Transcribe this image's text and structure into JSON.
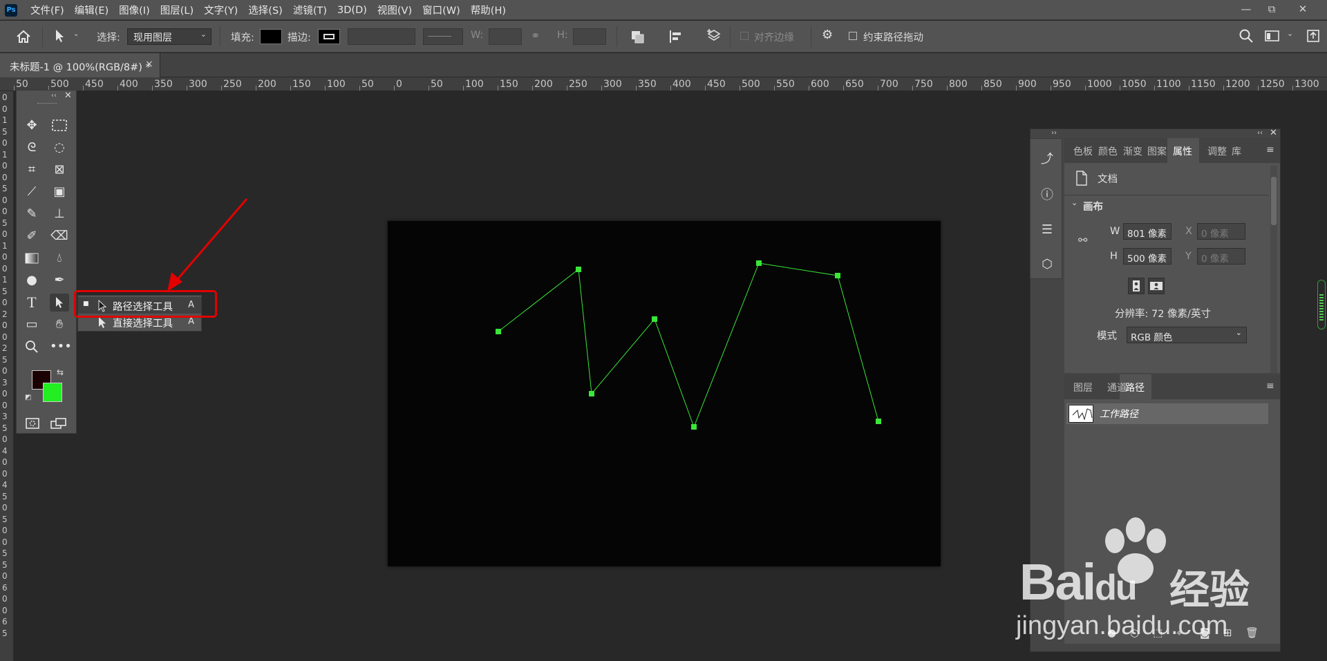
{
  "app": {
    "logo": "Ps"
  },
  "menu": [
    "文件(F)",
    "编辑(E)",
    "图像(I)",
    "图层(L)",
    "文字(Y)",
    "选择(S)",
    "滤镜(T)",
    "3D(D)",
    "视图(V)",
    "窗口(W)",
    "帮助(H)"
  ],
  "window_controls": {
    "minimize": "—",
    "restore": "⧉",
    "close": "✕"
  },
  "options": {
    "select_label": "选择:",
    "select_value": "现用图层",
    "fill_label": "填充:",
    "stroke_label": "描边:",
    "w_label": "W:",
    "h_label": "H:",
    "align_edges": "对齐边缘",
    "constrain_path": "约束路径拖动"
  },
  "document": {
    "tab_title": "未标题-1 @ 100%(RGB/8#) *",
    "close": "×"
  },
  "ruler_top": [
    "50",
    "500",
    "450",
    "400",
    "350",
    "300",
    "250",
    "200",
    "150",
    "100",
    "50",
    "0",
    "50",
    "100",
    "150",
    "200",
    "250",
    "300",
    "350",
    "400",
    "450",
    "500",
    "550",
    "600",
    "650",
    "700",
    "750",
    "800",
    "850",
    "900",
    "950",
    "1000",
    "1050",
    "1100",
    "1150",
    "1200",
    "1250",
    "1300"
  ],
  "ruler_left": [
    "0",
    "0",
    "1",
    "5",
    "0",
    "1",
    "0",
    "0",
    "5",
    "0",
    "0",
    "5",
    "0",
    "1",
    "0",
    "0",
    "1",
    "5",
    "0",
    "2",
    "0",
    "0",
    "2",
    "5",
    "0",
    "3",
    "0",
    "0",
    "3",
    "5",
    "0",
    "4",
    "0",
    "0",
    "4",
    "5",
    "0",
    "5",
    "0",
    "0",
    "5",
    "5",
    "0",
    "6",
    "0",
    "0",
    "6",
    "5"
  ],
  "flyout": {
    "items": [
      {
        "label": "路径选择工具",
        "key": "A"
      },
      {
        "label": "直接选择工具",
        "key": "A"
      }
    ]
  },
  "colors": {
    "foreground": "#1a0000",
    "background": "#22ee22",
    "path_color": "#39e639",
    "highlight": "#e30000"
  },
  "properties_panel": {
    "tabs": [
      "色板",
      "颜色",
      "渐变",
      "图案",
      "属性",
      "调整",
      "库"
    ],
    "active_tab": "属性",
    "doc_label": "文档",
    "canvas_section": "画布",
    "w_label": "W",
    "w_value": "801 像素",
    "h_label": "H",
    "h_value": "500 像素",
    "x_label": "X",
    "x_placeholder": "0 像素",
    "y_label": "Y",
    "y_placeholder": "0 像素",
    "resolution": "分辨率: 72 像素/英寸",
    "mode_label": "模式",
    "mode_value": "RGB 颜色"
  },
  "paths_panel": {
    "tabs": [
      "图层",
      "通道",
      "路径"
    ],
    "active_tab": "路径",
    "path_name": "工作路径"
  },
  "watermark": {
    "brand": "Bai",
    "brand2": "du",
    "cn": "经验",
    "url": "jingyan.baidu.com"
  }
}
